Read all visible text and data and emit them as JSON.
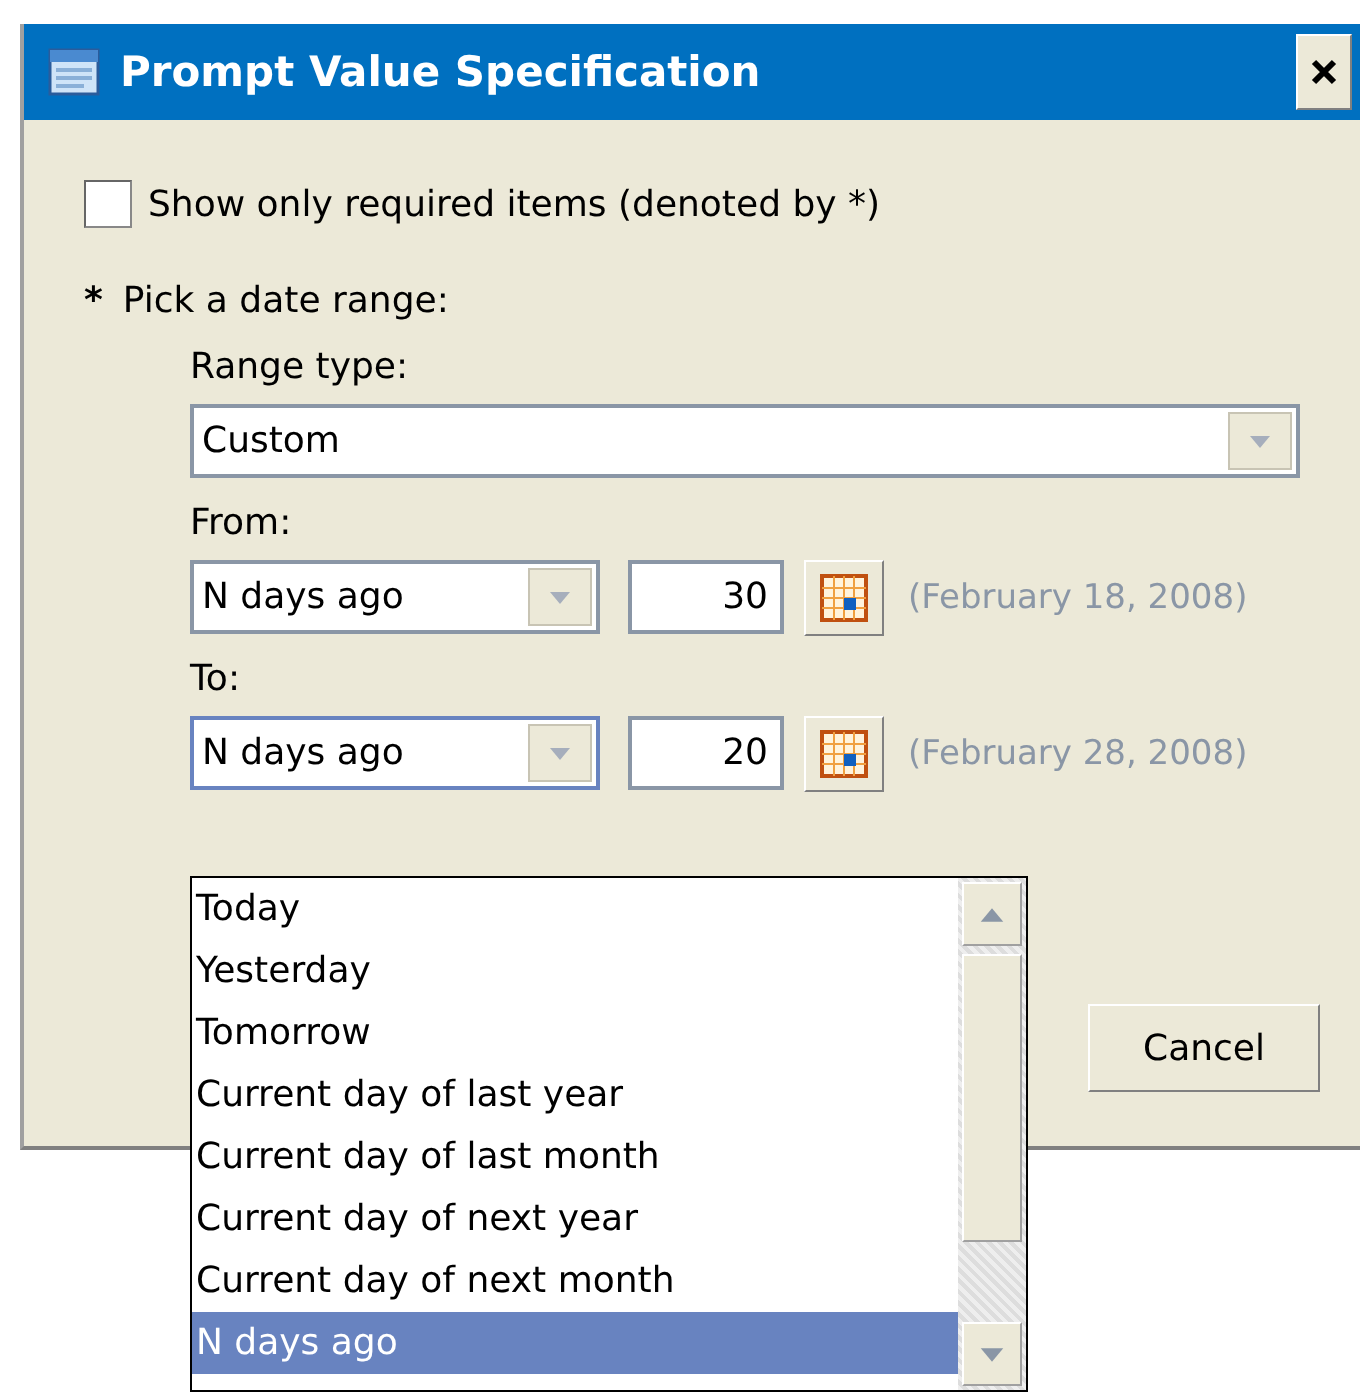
{
  "window": {
    "title": "Prompt Value Specification"
  },
  "required_only": {
    "label": "Show only required items (denoted by *)",
    "checked": false
  },
  "prompt": {
    "marker": "*",
    "label": "Pick a date range:"
  },
  "range_type": {
    "label": "Range type:",
    "value": "Custom"
  },
  "ranges": [
    {
      "label": "From:",
      "type": "N days ago",
      "count": "30",
      "date": "(February 18, 2008)",
      "open": false
    },
    {
      "label": "To:",
      "type": "N days ago",
      "count": "20",
      "date": "(February 28, 2008)",
      "open": true
    }
  ],
  "dropdown": {
    "items": [
      {
        "label": "Today",
        "selected": false
      },
      {
        "label": "Yesterday",
        "selected": false
      },
      {
        "label": "Tomorrow",
        "selected": false
      },
      {
        "label": "Current day of last year",
        "selected": false
      },
      {
        "label": "Current day of last month",
        "selected": false
      },
      {
        "label": "Current day of next year",
        "selected": false
      },
      {
        "label": "Current day of next month",
        "selected": false
      },
      {
        "label": "N days ago",
        "selected": true
      }
    ]
  },
  "buttons": [
    {
      "label": "Cancel"
    }
  ]
}
